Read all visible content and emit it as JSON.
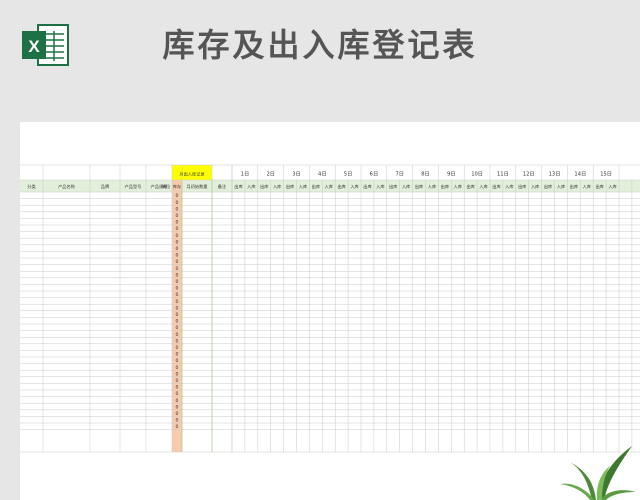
{
  "header": {
    "title": "库存及出入库登记表",
    "logo_letter": "X"
  },
  "sheet": {
    "month_label": "月出入库记录",
    "columns": [
      {
        "key": "category",
        "label": "分类"
      },
      {
        "key": "product_name",
        "label": "产品名称"
      },
      {
        "key": "brand",
        "label": "品牌"
      },
      {
        "key": "model",
        "label": "产品型号"
      },
      {
        "key": "spec",
        "label": "产品规格"
      },
      {
        "key": "unit",
        "label": "单位"
      },
      {
        "key": "stock",
        "label": "库存"
      },
      {
        "key": "opening_qty",
        "label": "月初始数量"
      },
      {
        "key": "remark",
        "label": "备注"
      }
    ],
    "days": [
      "1日",
      "2日",
      "3日",
      "4日",
      "5日",
      "6日",
      "7日",
      "8日",
      "9日",
      "10日",
      "11日",
      "12日",
      "13日",
      "14日",
      "15日"
    ],
    "out_label": "出库",
    "in_label": "入库",
    "stock_value": "0",
    "data_row_count": 36
  },
  "colors": {
    "header_green": "#e2efda",
    "label_yellow": "#ffff00",
    "stock_orange": "#f8cbad",
    "grid_line": "#c9c9c9",
    "excel_green": "#1e7145",
    "title_text": "#555555"
  },
  "icons": {
    "logo": "excel-icon",
    "decoration": "plant-icon"
  }
}
